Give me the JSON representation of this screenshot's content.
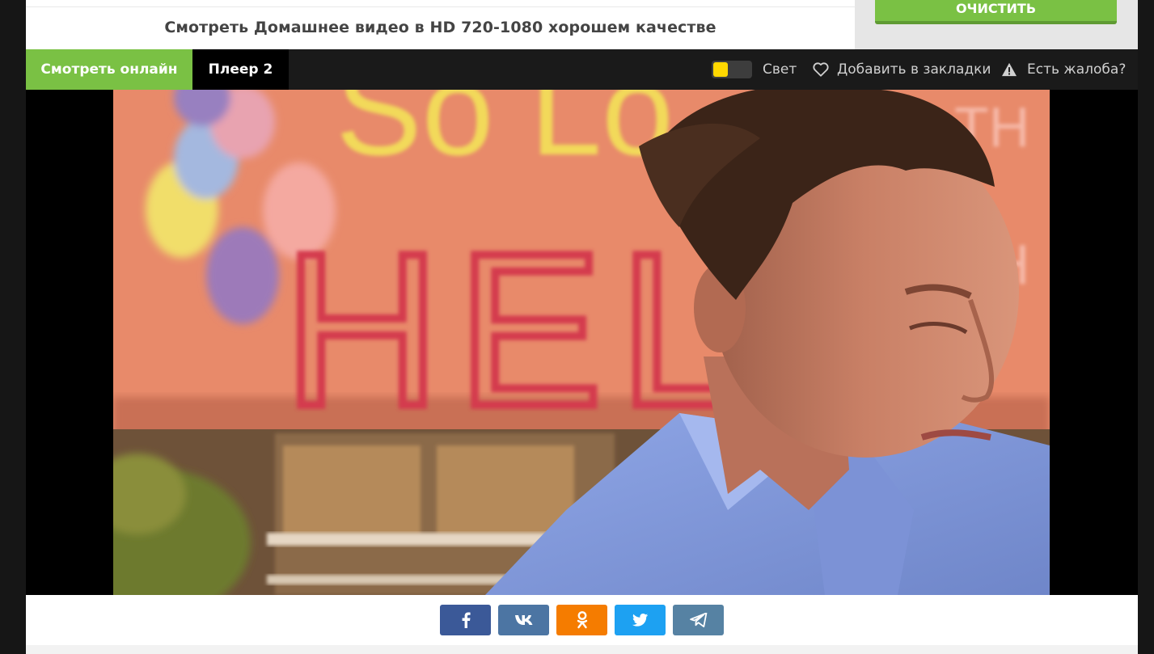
{
  "header": {
    "page_title": "Смотреть Домашнее видео в HD 720-1080 хорошем качестве",
    "clear_button": "ОЧИСТИТЬ"
  },
  "player_bar": {
    "tabs": [
      {
        "label": "Смотреть онлайн",
        "active": true
      },
      {
        "label": "Плеер 2",
        "active": false
      }
    ],
    "light_label": "Свет",
    "bookmark_label": "Добавить в закладки",
    "complaint_label": "Есть жалоба?"
  },
  "video": {
    "banner_line1": "So Lo",
    "banner_line2": "HELL",
    "banner_side1": "TH",
    "banner_side2": "TH"
  },
  "share": [
    {
      "network": "facebook",
      "glyph": "f",
      "color": "#3b5998"
    },
    {
      "network": "vk",
      "glyph": "vk",
      "color": "#4c75a3"
    },
    {
      "network": "odnoklassniki",
      "glyph": "ok",
      "color": "#f57c00"
    },
    {
      "network": "twitter",
      "glyph": "tw",
      "color": "#1da1f2"
    },
    {
      "network": "telegram",
      "glyph": "tg",
      "color": "#5682a3"
    }
  ],
  "colors": {
    "accent_green": "#7ac144",
    "toggle_yellow": "#ffd800",
    "bar_dark": "#1a1a1a"
  }
}
